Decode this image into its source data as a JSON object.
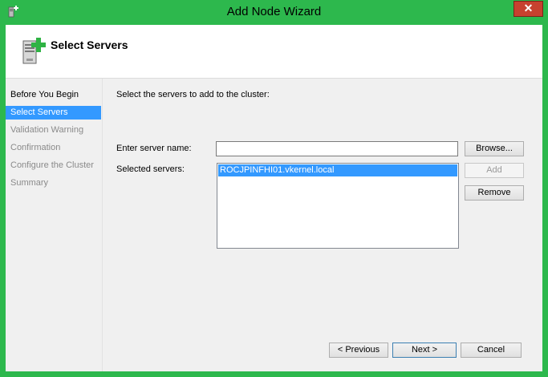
{
  "window": {
    "title": "Add Node Wizard",
    "close_glyph": "✕"
  },
  "header": {
    "title": "Select Servers",
    "icon": "server-add-icon"
  },
  "steps": [
    {
      "label": "Before You Begin",
      "state": "normal"
    },
    {
      "label": "Select Servers",
      "state": "active"
    },
    {
      "label": "Validation Warning",
      "state": "disabled"
    },
    {
      "label": "Confirmation",
      "state": "disabled"
    },
    {
      "label": "Configure the Cluster",
      "state": "disabled"
    },
    {
      "label": "Summary",
      "state": "disabled"
    }
  ],
  "main": {
    "instruction": "Select the servers to add to the cluster:",
    "server_name_label": "Enter server name:",
    "server_name_value": "",
    "selected_label": "Selected servers:",
    "selected_servers": [
      "ROCJPINFHI01.vkernel.local"
    ],
    "browse_label": "Browse...",
    "add_label": "Add",
    "remove_label": "Remove"
  },
  "footer": {
    "previous_label": "< Previous",
    "next_label": "Next >",
    "cancel_label": "Cancel"
  },
  "colors": {
    "frame": "#2db84d",
    "selection": "#3399ff",
    "close": "#c7412f"
  }
}
